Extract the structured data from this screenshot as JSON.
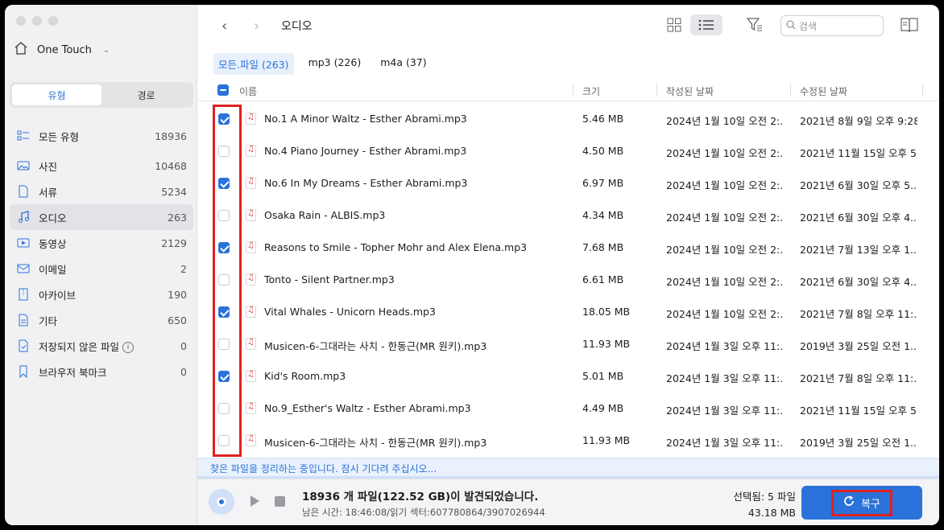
{
  "sidebar": {
    "drive_name": "One Touch",
    "segments": [
      "유형",
      "경로"
    ],
    "categories": [
      {
        "label": "모든 유형",
        "count": "18936"
      },
      {
        "label": "사진",
        "count": "10468"
      },
      {
        "label": "서류",
        "count": "5234"
      },
      {
        "label": "오디오",
        "count": "263"
      },
      {
        "label": "동영상",
        "count": "2129"
      },
      {
        "label": "이메일",
        "count": "2"
      },
      {
        "label": "아카이브",
        "count": "190"
      },
      {
        "label": "기타",
        "count": "650"
      },
      {
        "label": "저장되지 않은 파일",
        "count": "0"
      },
      {
        "label": "브라우저 북마크",
        "count": "0"
      }
    ]
  },
  "header": {
    "title": "오디오",
    "search_placeholder": "검색"
  },
  "tabs": [
    "모든.파일 (263)",
    "mp3 (226)",
    "m4a (37)"
  ],
  "columns": {
    "name": "이름",
    "size": "크기",
    "created": "작성된 날짜",
    "modified": "수정된 날짜"
  },
  "rows": [
    {
      "checked": true,
      "name": "No.1 A Minor Waltz - Esther Abrami.mp3",
      "size": "5.46 MB",
      "created": "2024년 1월 10일 오전 2:...",
      "modified": "2021년 8월 9일 오후 9:28"
    },
    {
      "checked": false,
      "name": "No.4 Piano Journey - Esther Abrami.mp3",
      "size": "4.50 MB",
      "created": "2024년 1월 10일 오전 2:...",
      "modified": "2021년 11월 15일 오후 5..."
    },
    {
      "checked": true,
      "name": "No.6 In My Dreams - Esther Abrami.mp3",
      "size": "6.97 MB",
      "created": "2024년 1월 10일 오전 2:...",
      "modified": "2021년 6월 30일 오후 5..."
    },
    {
      "checked": false,
      "name": "Osaka Rain - ALBIS.mp3",
      "size": "4.34 MB",
      "created": "2024년 1월 10일 오전 2:...",
      "modified": "2021년 6월 30일 오후 4..."
    },
    {
      "checked": true,
      "name": "Reasons to Smile - Topher Mohr and Alex Elena.mp3",
      "size": "7.68 MB",
      "created": "2024년 1월 10일 오전 2:...",
      "modified": "2021년 7월 13일 오후 1..."
    },
    {
      "checked": false,
      "name": "Tonto - Silent Partner.mp3",
      "size": "6.61 MB",
      "created": "2024년 1월 10일 오전 2:...",
      "modified": "2021년 6월 30일 오후 4..."
    },
    {
      "checked": true,
      "name": "Vital Whales - Unicorn Heads.mp3",
      "size": "18.05 MB",
      "created": "2024년 1월 10일 오전 2:...",
      "modified": "2021년 7월 8일 오후 11:..."
    },
    {
      "checked": false,
      "name": "Musicen-6-그대라는 사치 - 한동근(MR 원키).mp3",
      "size": "11.93 MB",
      "created": "2024년 1월 3일 오후 11:...",
      "modified": "2019년 3월 25일 오전 1..."
    },
    {
      "checked": true,
      "name": "Kid's Room.mp3",
      "size": "5.01 MB",
      "created": "2024년 1월 3일 오후 11:...",
      "modified": "2021년 7월 8일 오후 11:..."
    },
    {
      "checked": false,
      "name": "No.9_Esther's Waltz - Esther Abrami.mp3",
      "size": "4.49 MB",
      "created": "2024년 1월 3일 오후 11:...",
      "modified": "2021년 11월 15일 오후 5..."
    },
    {
      "checked": false,
      "name": "Musicen-6-그대라는 사치 - 한동근(MR 원키).mp3",
      "size": "11.93 MB",
      "created": "2024년 1월 3일 오후 11:...",
      "modified": "2019년 3월 25일 오전 1..."
    }
  ],
  "status": {
    "organizing": "찾은 파일을 정리하는 중입니다. 잠시 기다려 주십시오...",
    "found": "18936 개 파일(122.52 GB)이 발견되었습니다.",
    "meta": "남은 시간: 18:46:08/읽기 섹터:607780864/3907026944",
    "selected": "선택됨: 5 파일",
    "selected_size": "43.18 MB",
    "recover_label": "복구"
  },
  "colors": {
    "accent": "#2a72d9",
    "highlight": "#e02020"
  }
}
